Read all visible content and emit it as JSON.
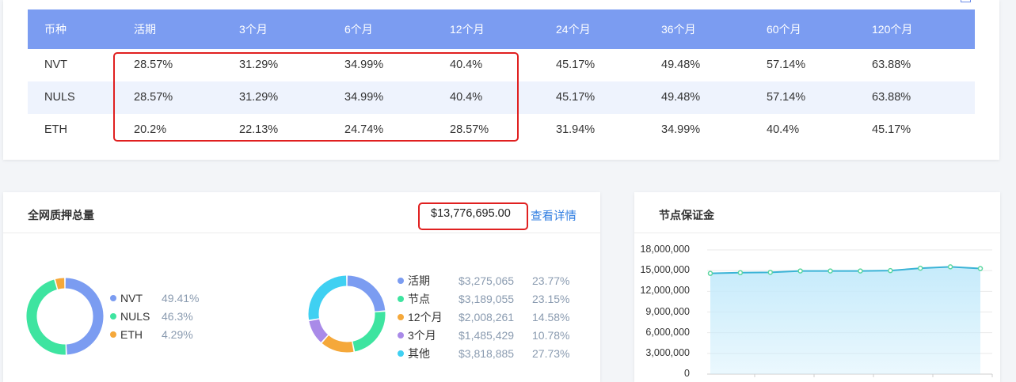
{
  "rate_table": {
    "headers": [
      "币种",
      "活期",
      "3个月",
      "6个月",
      "12个月",
      "24个月",
      "36个月",
      "60个月",
      "120个月"
    ],
    "rows": [
      {
        "coin": "NVT",
        "values": [
          "28.57%",
          "31.29%",
          "34.99%",
          "40.4%",
          "45.17%",
          "49.48%",
          "57.14%",
          "63.88%"
        ]
      },
      {
        "coin": "NULS",
        "values": [
          "28.57%",
          "31.29%",
          "34.99%",
          "40.4%",
          "45.17%",
          "49.48%",
          "57.14%",
          "63.88%"
        ]
      },
      {
        "coin": "ETH",
        "values": [
          "20.2%",
          "22.13%",
          "24.74%",
          "28.57%",
          "31.94%",
          "34.99%",
          "40.4%",
          "45.17%"
        ]
      }
    ]
  },
  "stake_panel": {
    "title": "全网质押总量",
    "total": "$13,776,695.00",
    "detail_link": "查看详情",
    "by_asset": [
      {
        "name": "NVT",
        "pct": "49.41%",
        "value": 49.41,
        "color": "#7b9cf1"
      },
      {
        "name": "NULS",
        "pct": "46.3%",
        "value": 46.3,
        "color": "#3ee4a0"
      },
      {
        "name": "ETH",
        "pct": "4.29%",
        "value": 4.29,
        "color": "#f5a83a"
      }
    ],
    "by_term": [
      {
        "name": "活期",
        "amount": "$3,275,065",
        "pct": "23.77%",
        "value": 23.77,
        "color": "#7b9cf1"
      },
      {
        "name": "节点",
        "amount": "$3,189,055",
        "pct": "23.15%",
        "value": 23.15,
        "color": "#3ee4a0"
      },
      {
        "name": "12个月",
        "amount": "$2,008,261",
        "pct": "14.58%",
        "value": 14.58,
        "color": "#f5a83a"
      },
      {
        "name": "3个月",
        "amount": "$1,485,429",
        "pct": "10.78%",
        "value": 10.78,
        "color": "#a98ae8"
      },
      {
        "name": "其他",
        "amount": "$3,818,885",
        "pct": "27.73%",
        "value": 27.73,
        "color": "#3fd0f2"
      }
    ]
  },
  "node_panel": {
    "title": "节点保证金",
    "chart_data": {
      "type": "area",
      "title": "节点保证金",
      "y_ticks": [
        "18,000,000",
        "15,000,000",
        "12,000,000",
        "9,000,000",
        "6,000,000",
        "3,000,000",
        "0"
      ],
      "ylim": [
        0,
        18000000
      ],
      "series": [
        {
          "values": [
            14600000,
            14700000,
            14750000,
            14950000,
            14950000,
            14950000,
            15000000,
            15350000,
            15550000,
            15300000
          ]
        }
      ],
      "line_color": "#3ab3d6",
      "fill_color": "#c6ebfb"
    }
  }
}
